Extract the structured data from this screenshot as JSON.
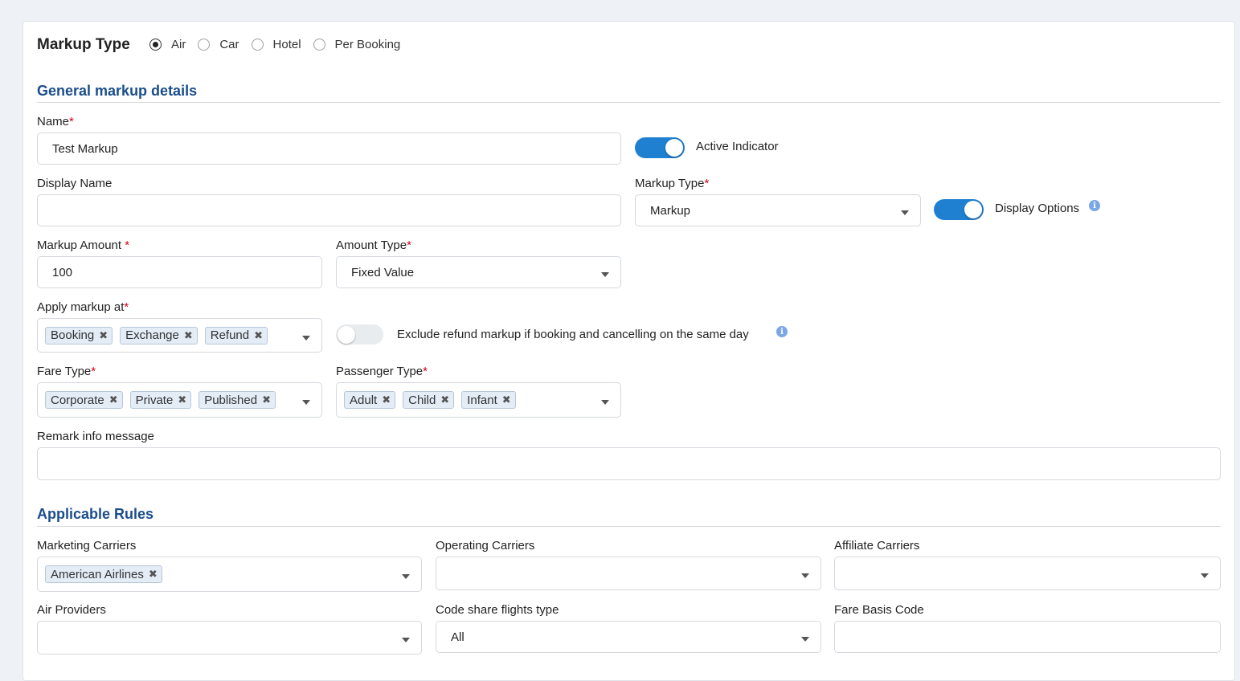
{
  "markup_type": {
    "title": "Markup Type",
    "options": [
      {
        "label": "Air",
        "checked": true
      },
      {
        "label": "Car",
        "checked": false
      },
      {
        "label": "Hotel",
        "checked": false
      },
      {
        "label": "Per Booking",
        "checked": false
      }
    ]
  },
  "general": {
    "section_title": "General markup details",
    "name_label": "Name",
    "name_value": "Test Markup",
    "active_indicator_label": "Active Indicator",
    "active_indicator_on": true,
    "display_name_label": "Display Name",
    "display_name_value": "",
    "markup_type_label": "Markup Type",
    "markup_type_value": "Markup",
    "display_options_label": "Display Options",
    "display_options_on": true,
    "markup_amount_label": "Markup Amount ",
    "markup_amount_value": "100",
    "amount_type_label": "Amount Type",
    "amount_type_value": "Fixed Value",
    "apply_markup_label": "Apply markup at",
    "apply_markup_tags": [
      "Booking",
      "Exchange",
      "Refund"
    ],
    "exclude_refund_label": "Exclude refund markup if booking and cancelling on the same day",
    "exclude_refund_on": false,
    "fare_type_label": "Fare Type",
    "fare_type_tags": [
      "Corporate",
      "Private",
      "Published"
    ],
    "passenger_type_label": "Passenger Type",
    "passenger_type_tags": [
      "Adult",
      "Child",
      "Infant"
    ],
    "remark_label": "Remark info message",
    "remark_value": "",
    "required_mark": "*"
  },
  "rules": {
    "section_title": "Applicable Rules",
    "marketing_carriers_label": "Marketing Carriers",
    "marketing_carriers_tags": [
      "American Airlines"
    ],
    "operating_carriers_label": "Operating Carriers",
    "affiliate_carriers_label": "Affiliate Carriers",
    "air_providers_label": "Air Providers",
    "code_share_label": "Code share flights type",
    "code_share_value": "All",
    "fare_basis_label": "Fare Basis Code"
  },
  "icons": {
    "info": "info-icon",
    "remove": "close-icon",
    "dropdown": "chevron-down-icon"
  },
  "colors": {
    "accent": "#1f7fd1",
    "section_title": "#1a4d8c",
    "required": "#d0021b"
  }
}
